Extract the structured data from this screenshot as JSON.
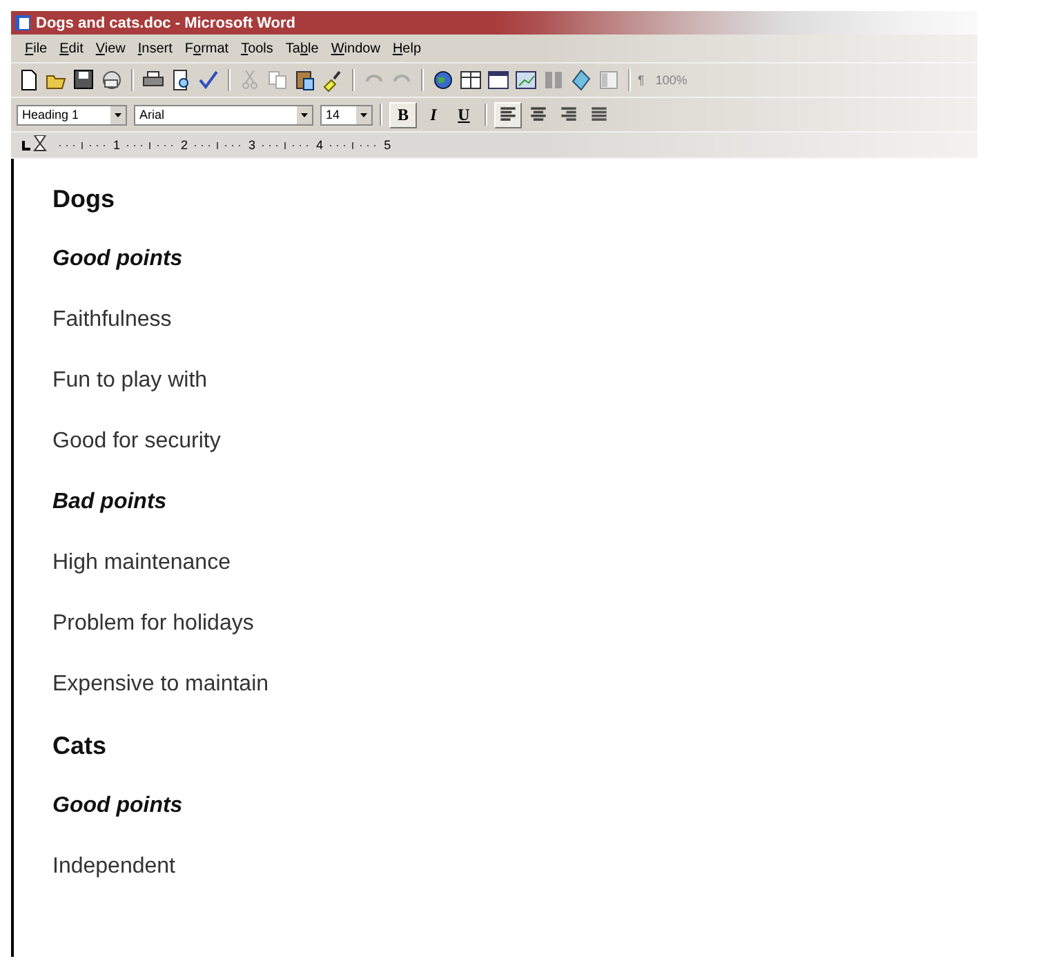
{
  "window": {
    "title": "Dogs and cats.doc - Microsoft Word"
  },
  "menu": [
    "File",
    "Edit",
    "View",
    "Insert",
    "Format",
    "Tools",
    "Table",
    "Window",
    "Help"
  ],
  "standard_toolbar": {
    "pilcrow": "¶",
    "zoom": "100%"
  },
  "formatting_toolbar": {
    "style": "Heading 1",
    "font": "Arial",
    "size": "14",
    "styles": [
      {
        "label": "B",
        "on": true,
        "kind": "bold"
      },
      {
        "label": "I",
        "on": false,
        "kind": "italic"
      },
      {
        "label": "U",
        "on": false,
        "kind": "underline"
      }
    ],
    "alignment": [
      {
        "kind": "left",
        "selected": true
      },
      {
        "kind": "center",
        "selected": false
      },
      {
        "kind": "right",
        "selected": false
      },
      {
        "kind": "justify",
        "selected": false
      }
    ]
  },
  "ruler": {
    "numbers": [
      "1",
      "2",
      "3",
      "4",
      "5"
    ]
  },
  "document": [
    {
      "kind": "heading",
      "text": "Dogs"
    },
    {
      "kind": "subheading",
      "text": "Good points"
    },
    {
      "kind": "body",
      "text": "Faithfulness"
    },
    {
      "kind": "body",
      "text": "Fun to play with"
    },
    {
      "kind": "body",
      "text": "Good for security"
    },
    {
      "kind": "subheading",
      "text": "Bad points"
    },
    {
      "kind": "body",
      "text": "High maintenance"
    },
    {
      "kind": "body",
      "text": "Problem for holidays"
    },
    {
      "kind": "body",
      "text": "Expensive to maintain"
    },
    {
      "kind": "heading",
      "text": "Cats"
    },
    {
      "kind": "subheading",
      "text": "Good points"
    },
    {
      "kind": "body",
      "text": "Independent"
    }
  ]
}
